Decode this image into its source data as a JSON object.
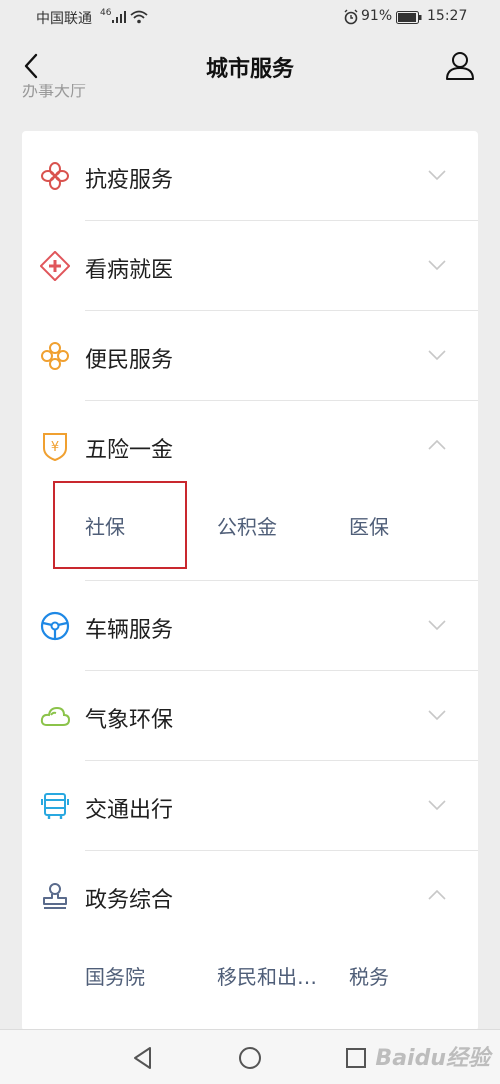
{
  "status_bar": {
    "carrier": "中国联通",
    "network": "46",
    "battery_percent": "91%",
    "time": "15:27"
  },
  "nav": {
    "title": "城市服务"
  },
  "section_peek": "办事大厅",
  "colors": {
    "highlight_border": "#c9282e",
    "sub_item_text": "#4f5e78",
    "epidemic_icon": "#d9534f",
    "medical_icon": "#e0565b",
    "convenience_icon": "#f0a030",
    "insurance_icon": "#f0a030",
    "vehicle_icon": "#1e88e5",
    "weather_icon": "#8bc34a",
    "transport_icon": "#29a8e0",
    "government_icon": "#5a6b8c"
  },
  "categories": [
    {
      "label": "抗疫服务",
      "icon": "epidemic-icon",
      "expanded": false
    },
    {
      "label": "看病就医",
      "icon": "medical-cross-icon",
      "expanded": false
    },
    {
      "label": "便民服务",
      "icon": "convenience-flower-icon",
      "expanded": false
    },
    {
      "label": "五险一金",
      "icon": "yuan-shield-icon",
      "expanded": true,
      "items": [
        "社保",
        "公积金",
        "医保"
      ]
    },
    {
      "label": "车辆服务",
      "icon": "steering-wheel-icon",
      "expanded": false
    },
    {
      "label": "气象环保",
      "icon": "cloud-icon",
      "expanded": false
    },
    {
      "label": "交通出行",
      "icon": "bus-icon",
      "expanded": false
    },
    {
      "label": "政务综合",
      "icon": "stamp-icon",
      "expanded": true,
      "items": [
        "国务院",
        "移民和出…",
        "税务"
      ]
    }
  ],
  "watermark": "Baidu经验"
}
